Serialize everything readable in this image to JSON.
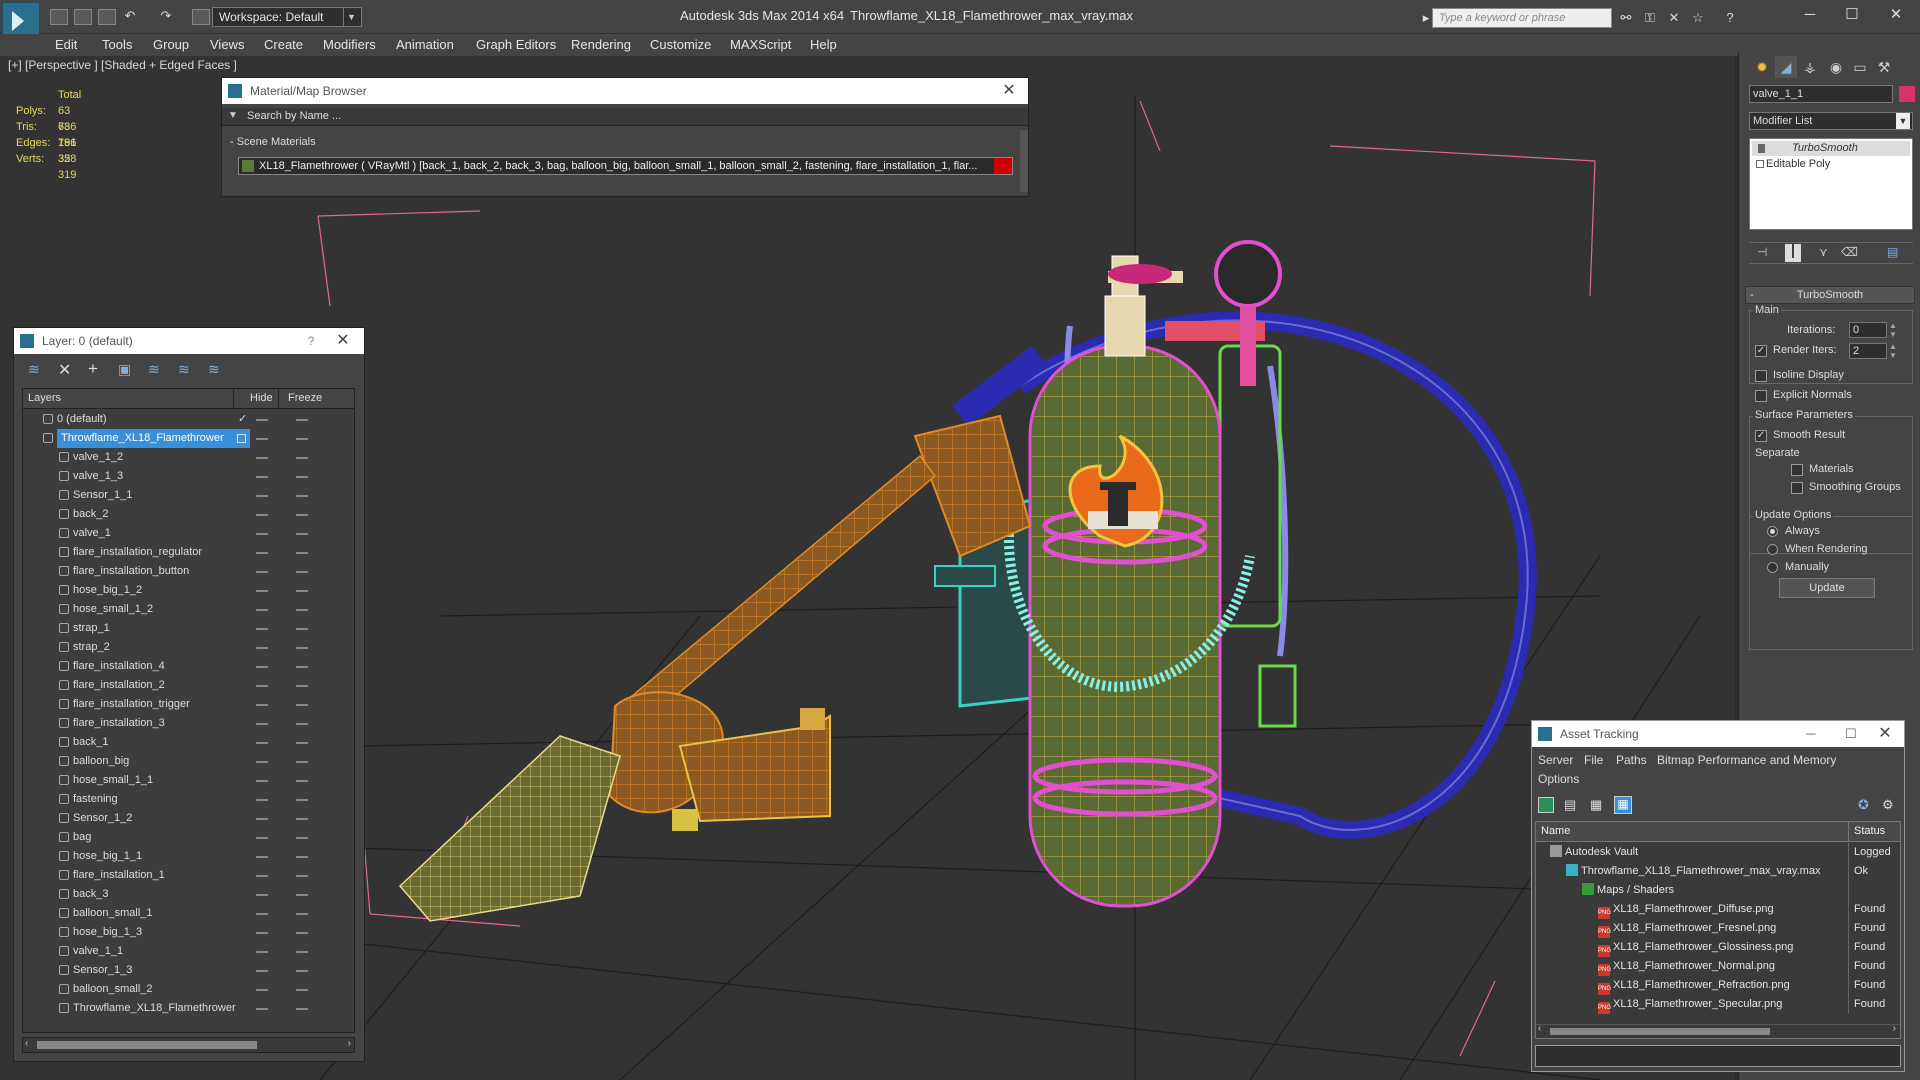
{
  "app": {
    "title": "Autodesk 3ds Max  2014 x64",
    "document": "Throwflame_XL18_Flamethrower_max_vray.max",
    "workspace": "Workspace: Default",
    "search_placeholder": "Type a keyword or phrase"
  },
  "menu": [
    "Edit",
    "Tools",
    "Group",
    "Views",
    "Create",
    "Modifiers",
    "Animation",
    "Graph Editors",
    "Rendering",
    "Customize",
    "MAXScript",
    "Help"
  ],
  "viewport": {
    "label": "[+] [Perspective ] [Shaded + Edged Faces ]",
    "stats": {
      "header": "Total",
      "rows": [
        {
          "label": "Polys:",
          "value": "63 786"
        },
        {
          "label": "Tris:",
          "value": "63 786"
        },
        {
          "label": "Edges:",
          "value": "191 358"
        },
        {
          "label": "Verts:",
          "value": "32 319"
        }
      ]
    }
  },
  "material_browser": {
    "title": "Material/Map Browser",
    "search_placeholder": "Search by Name ...",
    "section": "- Scene Materials",
    "item": "XL18_Flamethrower  ( VRayMtl ) [back_1, back_2, back_3, bag, balloon_big, balloon_small_1, balloon_small_2, fastening, flare_installation_1, flar..."
  },
  "layer_panel": {
    "title": "Layer: 0 (default)",
    "help": "?",
    "columns": {
      "layers": "Layers",
      "hide": "Hide",
      "freeze": "Freeze"
    },
    "default_layer": "0 (default)",
    "active_layer": "Throwflame_XL18_Flamethrower",
    "objects": [
      "valve_1_2",
      "valve_1_3",
      "Sensor_1_1",
      "back_2",
      "valve_1",
      "flare_installation_regulator",
      "flare_installation_button",
      "hose_big_1_2",
      "hose_small_1_2",
      "strap_1",
      "strap_2",
      "flare_installation_4",
      "flare_installation_2",
      "flare_installation_trigger",
      "flare_installation_3",
      "back_1",
      "balloon_big",
      "hose_small_1_1",
      "fastening",
      "Sensor_1_2",
      "bag",
      "hose_big_1_1",
      "flare_installation_1",
      "back_3",
      "balloon_small_1",
      "hose_big_1_3",
      "valve_1_1",
      "Sensor_1_3",
      "balloon_small_2",
      "Throwflame_XL18_Flamethrower"
    ]
  },
  "command_panel": {
    "object_name": "valve_1_1",
    "object_color": "#d6336c",
    "modifier_list": "Modifier List",
    "stack": [
      "TurboSmooth",
      "Editable Poly"
    ],
    "rollout": "TurboSmooth",
    "main": "Main",
    "iterations_label": "Iterations:",
    "iterations": "0",
    "render_iters_label": "Render Iters:",
    "render_iters": "2",
    "isoline": "Isoline Display",
    "explicit": "Explicit Normals",
    "surface": "Surface Parameters",
    "smooth_result": "Smooth Result",
    "separate": "Separate",
    "materials": "Materials",
    "smoothing_groups": "Smoothing Groups",
    "update_options": "Update Options",
    "always": "Always",
    "when_rendering": "When Rendering",
    "manually": "Manually",
    "update": "Update"
  },
  "asset_tracking": {
    "title": "Asset Tracking",
    "menu": [
      "Server",
      "File",
      "Paths",
      "Bitmap Performance and Memory"
    ],
    "options": "Options",
    "col_name": "Name",
    "col_status": "Status",
    "rows": [
      {
        "name": "Autodesk Vault",
        "status": "Logged",
        "indent": 1,
        "type": "vault"
      },
      {
        "name": "Throwflame_XL18_Flamethrower_max_vray.max",
        "status": "Ok",
        "indent": 2,
        "type": "max"
      },
      {
        "name": "Maps / Shaders",
        "status": "",
        "indent": 3,
        "type": "folder"
      },
      {
        "name": "XL18_Flamethrower_Diffuse.png",
        "status": "Found",
        "indent": 4,
        "type": "png"
      },
      {
        "name": "XL18_Flamethrower_Fresnel.png",
        "status": "Found",
        "indent": 4,
        "type": "png"
      },
      {
        "name": "XL18_Flamethrower_Glossiness.png",
        "status": "Found",
        "indent": 4,
        "type": "png"
      },
      {
        "name": "XL18_Flamethrower_Normal.png",
        "status": "Found",
        "indent": 4,
        "type": "png"
      },
      {
        "name": "XL18_Flamethrower_Refraction.png",
        "status": "Found",
        "indent": 4,
        "type": "png"
      },
      {
        "name": "XL18_Flamethrower_Specular.png",
        "status": "Found",
        "indent": 4,
        "type": "png"
      }
    ]
  },
  "colors": {
    "accent": "#3b8ed8",
    "bbox": "#e06a8a",
    "tank": "#556b2f",
    "wire_pink": "#e24fd0",
    "hose_blue": "#2a2bb0",
    "cyan": "#3ad1c0",
    "orange": "#c8741c",
    "green": "#6bd94a"
  }
}
